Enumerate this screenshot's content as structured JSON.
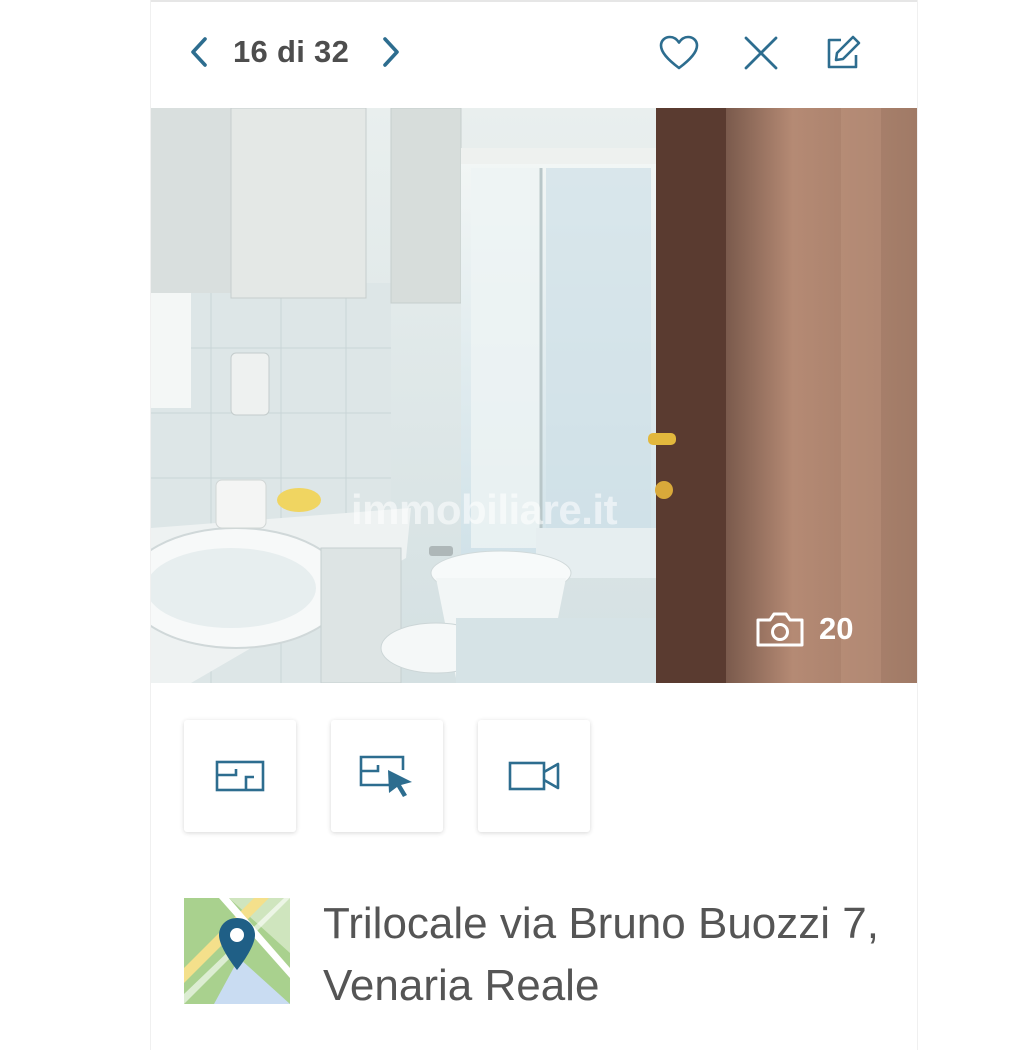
{
  "header": {
    "counter": "16 di 32",
    "prev_icon": "chevron-left-icon",
    "next_icon": "chevron-right-icon",
    "favorite_icon": "heart-icon",
    "close_icon": "close-icon",
    "edit_icon": "edit-icon",
    "accent_color": "#2d6d8f"
  },
  "photo": {
    "watermark": "immobiliare.it",
    "photo_count": "20",
    "camera_icon": "camera-icon"
  },
  "toolbar": {
    "items": [
      {
        "icon": "floorplan-icon"
      },
      {
        "icon": "virtual-tour-icon"
      },
      {
        "icon": "video-icon"
      }
    ]
  },
  "listing": {
    "title": "Trilocale via Bruno Buozzi 7, Venaria Reale",
    "map_icon": "map-pin-icon"
  }
}
